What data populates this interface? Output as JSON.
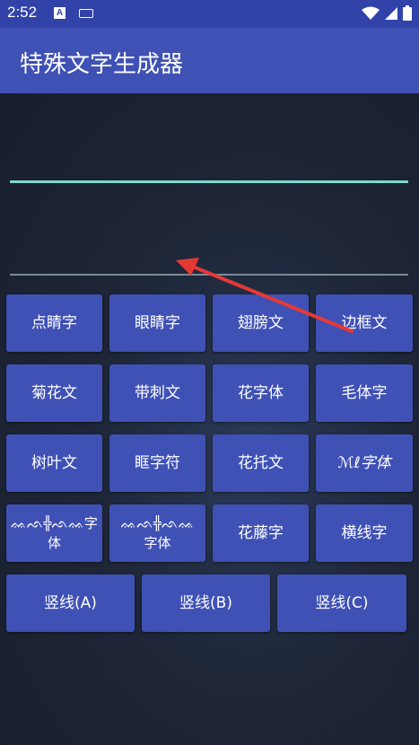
{
  "status_bar": {
    "time": "2:52",
    "icons": [
      "a-badge-icon",
      "keyboard-icon",
      "wifi-icon",
      "cellular-icon",
      "battery-icon"
    ]
  },
  "app_bar": {
    "title": "特殊文字生成器"
  },
  "input": {
    "value": "",
    "output": ""
  },
  "buttons": {
    "row1": [
      "点睛字",
      "眼睛字",
      "翅膀文",
      "边框文"
    ],
    "row2": [
      "菊花文",
      "带刺文",
      "花字体",
      "毛体字"
    ],
    "row3": [
      "树叶文",
      "眶字符",
      "花托文",
      "ℳℓ字体"
    ],
    "row4": [
      "ᨐᨒ╬ᨒᨐ字体",
      "ᨐᨒ╬ᨒᨐ字体",
      "花藤字",
      "横线字"
    ],
    "row5": [
      "竖线(A)",
      "竖线(B)",
      "竖线(C)"
    ]
  },
  "colors": {
    "status_bar": "#3142a8",
    "app_bar": "#3f51b5",
    "button": "#3f51b5",
    "input_underline_focused": "#7dd8cf",
    "annotation_arrow": "#e53935"
  }
}
